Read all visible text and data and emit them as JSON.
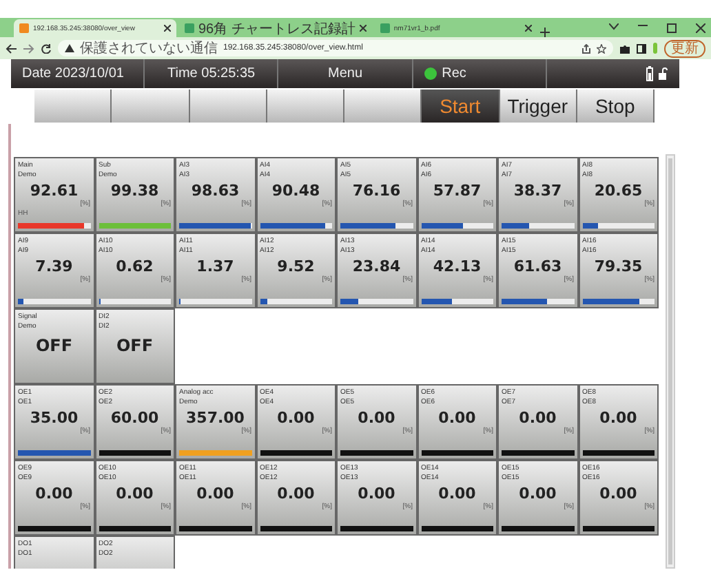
{
  "browser": {
    "tabs": [
      {
        "title": "192.168.35.245:38080/over_view",
        "selected": true
      },
      {
        "title": "96角 チャートレス記録計",
        "selected": false
      },
      {
        "title": "nm71vr1_b.pdf",
        "selected": false
      }
    ],
    "security": "保護されていない通信",
    "url": "192.168.35.245:38080/over_view.html",
    "update_button": "更新"
  },
  "header": {
    "date": "Date 2023/10/01",
    "time": "Time 05:25:35",
    "menu": "Menu",
    "rec": "Rec",
    "recording": true
  },
  "controls": [
    {
      "label": "Start",
      "selected": true
    },
    {
      "label": "Trigger",
      "selected": false
    },
    {
      "label": "Stop",
      "selected": false
    }
  ],
  "tile_rows": [
    [
      {
        "kind": "analog",
        "name": "Main",
        "sub": "Demo",
        "value": "92.61",
        "unit": "[%]",
        "alarm": "HH",
        "level": 0.92,
        "color": "#e8372a"
      },
      {
        "kind": "analog",
        "name": "Sub",
        "sub": "Demo",
        "value": "99.38",
        "unit": "[%]",
        "level": 1,
        "color": "#6cbf3a"
      },
      {
        "kind": "analog",
        "name": "AI3",
        "sub": "AI3",
        "value": "98.63",
        "unit": "[%]",
        "level": 0.99,
        "color": "#2456b0"
      },
      {
        "kind": "analog",
        "name": "AI4",
        "sub": "AI4",
        "value": "90.48",
        "unit": "[%]",
        "level": 0.9,
        "color": "#2456b0"
      },
      {
        "kind": "analog",
        "name": "AI5",
        "sub": "AI5",
        "value": "76.16",
        "unit": "[%]",
        "level": 0.76,
        "color": "#2456b0"
      },
      {
        "kind": "analog",
        "name": "AI6",
        "sub": "AI6",
        "value": "57.87",
        "unit": "[%]",
        "level": 0.58,
        "color": "#2456b0"
      },
      {
        "kind": "analog",
        "name": "AI7",
        "sub": "AI7",
        "value": "38.37",
        "unit": "[%]",
        "level": 0.38,
        "color": "#2456b0"
      },
      {
        "kind": "analog",
        "name": "AI8",
        "sub": "AI8",
        "value": "20.65",
        "unit": "[%]",
        "level": 0.21,
        "color": "#2456b0"
      }
    ],
    [
      {
        "kind": "analog",
        "name": "AI9",
        "sub": "AI9",
        "value": "7.39",
        "unit": "[%]",
        "level": 0.07,
        "color": "#2456b0"
      },
      {
        "kind": "analog",
        "name": "AI10",
        "sub": "AI10",
        "value": "0.62",
        "unit": "[%]",
        "level": 0.01,
        "color": "#2456b0"
      },
      {
        "kind": "analog",
        "name": "AI11",
        "sub": "AI11",
        "value": "1.37",
        "unit": "[%]",
        "level": 0.02,
        "color": "#2456b0"
      },
      {
        "kind": "analog",
        "name": "AI12",
        "sub": "AI12",
        "value": "9.52",
        "unit": "[%]",
        "level": 0.1,
        "color": "#2456b0"
      },
      {
        "kind": "analog",
        "name": "AI13",
        "sub": "AI13",
        "value": "23.84",
        "unit": "[%]",
        "level": 0.24,
        "color": "#2456b0"
      },
      {
        "kind": "analog",
        "name": "AI14",
        "sub": "AI14",
        "value": "42.13",
        "unit": "[%]",
        "level": 0.42,
        "color": "#2456b0"
      },
      {
        "kind": "analog",
        "name": "AI15",
        "sub": "AI15",
        "value": "61.63",
        "unit": "[%]",
        "level": 0.62,
        "color": "#2456b0"
      },
      {
        "kind": "analog",
        "name": "AI16",
        "sub": "AI16",
        "value": "79.35",
        "unit": "[%]",
        "level": 0.79,
        "color": "#2456b0"
      }
    ],
    [
      {
        "kind": "digital",
        "name": "Signal",
        "sub": "Demo",
        "value": "OFF"
      },
      {
        "kind": "digital",
        "name": "DI2",
        "sub": "DI2",
        "value": "OFF"
      }
    ],
    [
      {
        "kind": "analog",
        "name": "OE1",
        "sub": "OE1",
        "value": "35.00",
        "unit": "[%]",
        "level": 1,
        "color": "#2456b0"
      },
      {
        "kind": "analog",
        "name": "OE2",
        "sub": "OE2",
        "value": "60.00",
        "unit": "[%]",
        "level": 1,
        "color": "#111111"
      },
      {
        "kind": "analog",
        "name": "Analog acc",
        "sub": "Demo",
        "value": "357.00",
        "unit": "[%]",
        "level": 1,
        "color": "#f0a020"
      },
      {
        "kind": "analog",
        "name": "OE4",
        "sub": "OE4",
        "value": "0.00",
        "unit": "[%]",
        "level": 1,
        "color": "#111111"
      },
      {
        "kind": "analog",
        "name": "OE5",
        "sub": "OE5",
        "value": "0.00",
        "unit": "[%]",
        "level": 1,
        "color": "#111111"
      },
      {
        "kind": "analog",
        "name": "OE6",
        "sub": "OE6",
        "value": "0.00",
        "unit": "[%]",
        "level": 1,
        "color": "#111111"
      },
      {
        "kind": "analog",
        "name": "OE7",
        "sub": "OE7",
        "value": "0.00",
        "unit": "[%]",
        "level": 1,
        "color": "#111111"
      },
      {
        "kind": "analog",
        "name": "OE8",
        "sub": "OE8",
        "value": "0.00",
        "unit": "[%]",
        "level": 1,
        "color": "#111111"
      }
    ],
    [
      {
        "kind": "analog",
        "name": "OE9",
        "sub": "OE9",
        "value": "0.00",
        "unit": "[%]",
        "level": 1,
        "color": "#111111"
      },
      {
        "kind": "analog",
        "name": "OE10",
        "sub": "OE10",
        "value": "0.00",
        "unit": "[%]",
        "level": 1,
        "color": "#111111"
      },
      {
        "kind": "analog",
        "name": "OE11",
        "sub": "OE11",
        "value": "0.00",
        "unit": "[%]",
        "level": 1,
        "color": "#111111"
      },
      {
        "kind": "analog",
        "name": "OE12",
        "sub": "OE12",
        "value": "0.00",
        "unit": "[%]",
        "level": 1,
        "color": "#111111"
      },
      {
        "kind": "analog",
        "name": "OE13",
        "sub": "OE13",
        "value": "0.00",
        "unit": "[%]",
        "level": 1,
        "color": "#111111"
      },
      {
        "kind": "analog",
        "name": "OE14",
        "sub": "OE14",
        "value": "0.00",
        "unit": "[%]",
        "level": 1,
        "color": "#111111"
      },
      {
        "kind": "analog",
        "name": "OE15",
        "sub": "OE15",
        "value": "0.00",
        "unit": "[%]",
        "level": 1,
        "color": "#111111"
      },
      {
        "kind": "analog",
        "name": "OE16",
        "sub": "OE16",
        "value": "0.00",
        "unit": "[%]",
        "level": 1,
        "color": "#111111"
      }
    ],
    [
      {
        "kind": "stub",
        "name": "DO1",
        "sub": "DO1"
      },
      {
        "kind": "stub",
        "name": "DO2",
        "sub": "DO2"
      }
    ]
  ]
}
